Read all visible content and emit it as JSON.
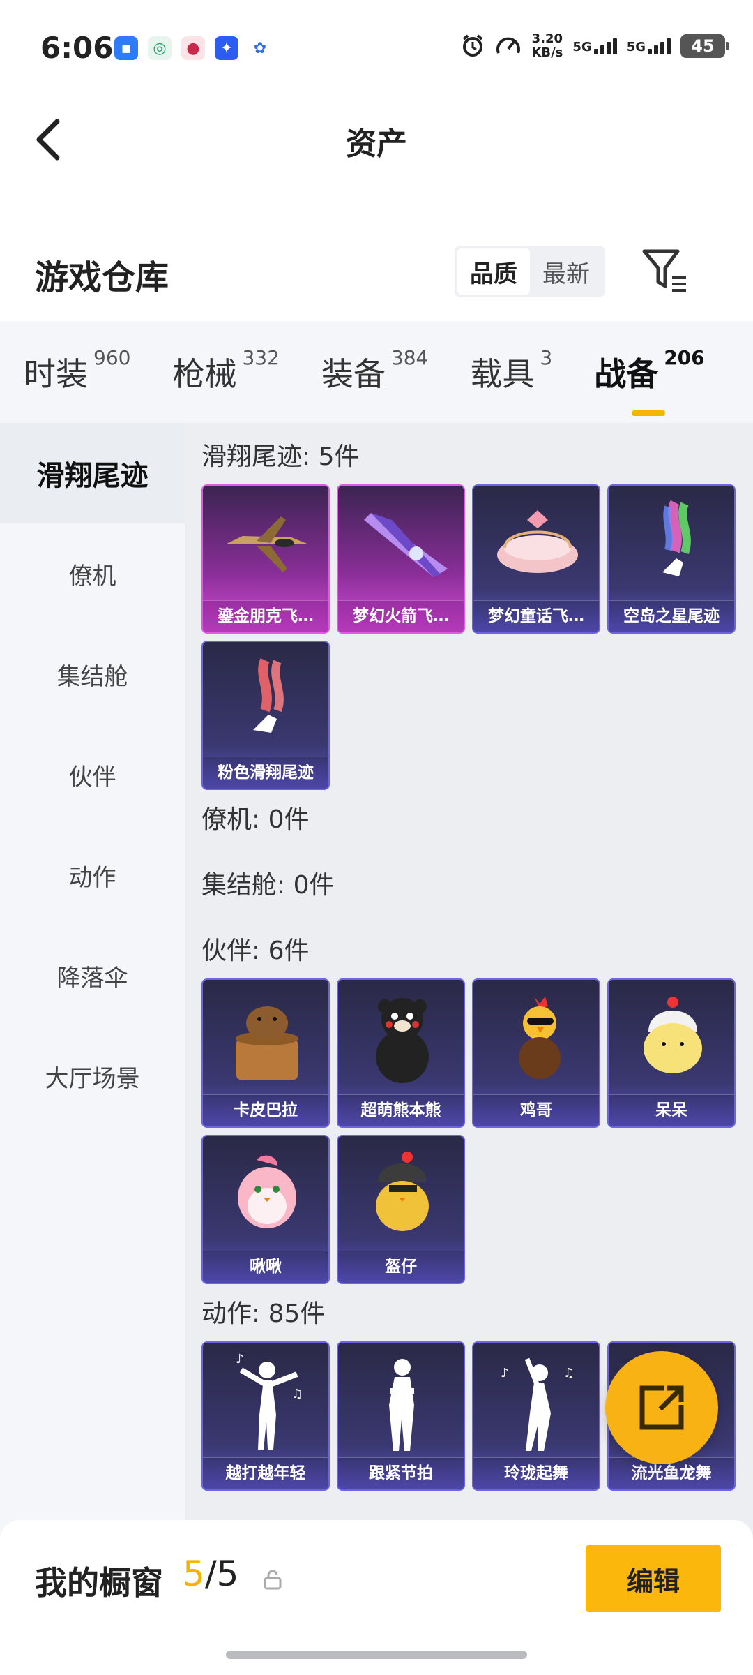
{
  "status_bar": {
    "time": "6:06",
    "speed_value": "3.20",
    "speed_unit": "KB/s",
    "net1": "5G",
    "net2": "5G",
    "battery": "45"
  },
  "header": {
    "title": "资产"
  },
  "warehouse": {
    "title": "游戏仓库",
    "sort_options": [
      "品质",
      "最新"
    ],
    "sort_selected": "品质"
  },
  "tabs": [
    {
      "label": "时装",
      "count": "960"
    },
    {
      "label": "枪械",
      "count": "332"
    },
    {
      "label": "装备",
      "count": "384"
    },
    {
      "label": "载具",
      "count": "3"
    },
    {
      "label": "战备",
      "count": "206",
      "active": true
    }
  ],
  "sidebar": {
    "items": [
      "滑翔尾迹",
      "僚机",
      "集结舱",
      "伙伴",
      "动作",
      "降落伞",
      "大厅场景"
    ],
    "active": "滑翔尾迹"
  },
  "sections": {
    "glide": {
      "title": "滑翔尾迹: 5件",
      "items": [
        "鎏金朋克飞…",
        "梦幻火箭飞…",
        "梦幻童话飞…",
        "空岛之星尾迹",
        "粉色滑翔尾迹"
      ]
    },
    "wingman": {
      "title": "僚机: 0件"
    },
    "assembly": {
      "title": "集结舱: 0件"
    },
    "partner": {
      "title": "伙伴: 6件",
      "items": [
        "卡皮巴拉",
        "超萌熊本熊",
        "鸡哥",
        "呆呆",
        "啾啾",
        "盔仔"
      ]
    },
    "emote": {
      "title": "动作: 85件",
      "items": [
        "越打越年轻",
        "跟紧节拍",
        "玲珑起舞",
        "流光鱼龙舞"
      ]
    }
  },
  "bottom_bar": {
    "title": "我的橱窗",
    "count_current": "5",
    "count_sep": "/",
    "count_total": "5",
    "edit_label": "编辑"
  },
  "colors": {
    "accent": "#fbb70b",
    "card_purple": "#5b54c7",
    "card_epic": "#d54fd8"
  }
}
